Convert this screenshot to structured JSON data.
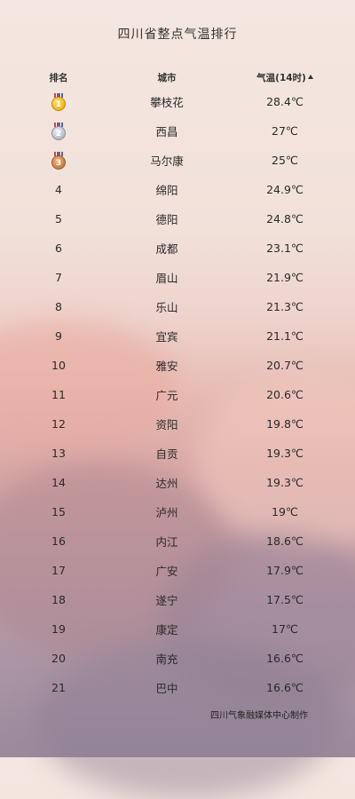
{
  "title": "四川省整点气温排行",
  "header": {
    "rank": "排名",
    "city": "城市",
    "temp": "气温(14时)"
  },
  "rows": [
    {
      "rank": "1",
      "medal": "gold",
      "city": "攀枝花",
      "temp": "28.4℃"
    },
    {
      "rank": "2",
      "medal": "silver",
      "city": "西昌",
      "temp": "27℃"
    },
    {
      "rank": "3",
      "medal": "bronze",
      "city": "马尔康",
      "temp": "25℃"
    },
    {
      "rank": "4",
      "city": "绵阳",
      "temp": "24.9℃"
    },
    {
      "rank": "5",
      "city": "德阳",
      "temp": "24.8℃"
    },
    {
      "rank": "6",
      "city": "成都",
      "temp": "23.1℃"
    },
    {
      "rank": "7",
      "city": "眉山",
      "temp": "21.9℃"
    },
    {
      "rank": "8",
      "city": "乐山",
      "temp": "21.3℃"
    },
    {
      "rank": "9",
      "city": "宜宾",
      "temp": "21.1℃"
    },
    {
      "rank": "10",
      "city": "雅安",
      "temp": "20.7℃"
    },
    {
      "rank": "11",
      "city": "广元",
      "temp": "20.6℃"
    },
    {
      "rank": "12",
      "city": "资阳",
      "temp": "19.8℃"
    },
    {
      "rank": "13",
      "city": "自贡",
      "temp": "19.3℃"
    },
    {
      "rank": "14",
      "city": "达州",
      "temp": "19.3℃"
    },
    {
      "rank": "15",
      "city": "泸州",
      "temp": "19℃"
    },
    {
      "rank": "16",
      "city": "内江",
      "temp": "18.6℃"
    },
    {
      "rank": "17",
      "city": "广安",
      "temp": "17.9℃"
    },
    {
      "rank": "18",
      "city": "遂宁",
      "temp": "17.5℃"
    },
    {
      "rank": "19",
      "city": "康定",
      "temp": "17℃"
    },
    {
      "rank": "20",
      "city": "南充",
      "temp": "16.6℃"
    },
    {
      "rank": "21",
      "city": "巴中",
      "temp": "16.6℃"
    }
  ],
  "footer": "四川气象融媒体中心制作"
}
